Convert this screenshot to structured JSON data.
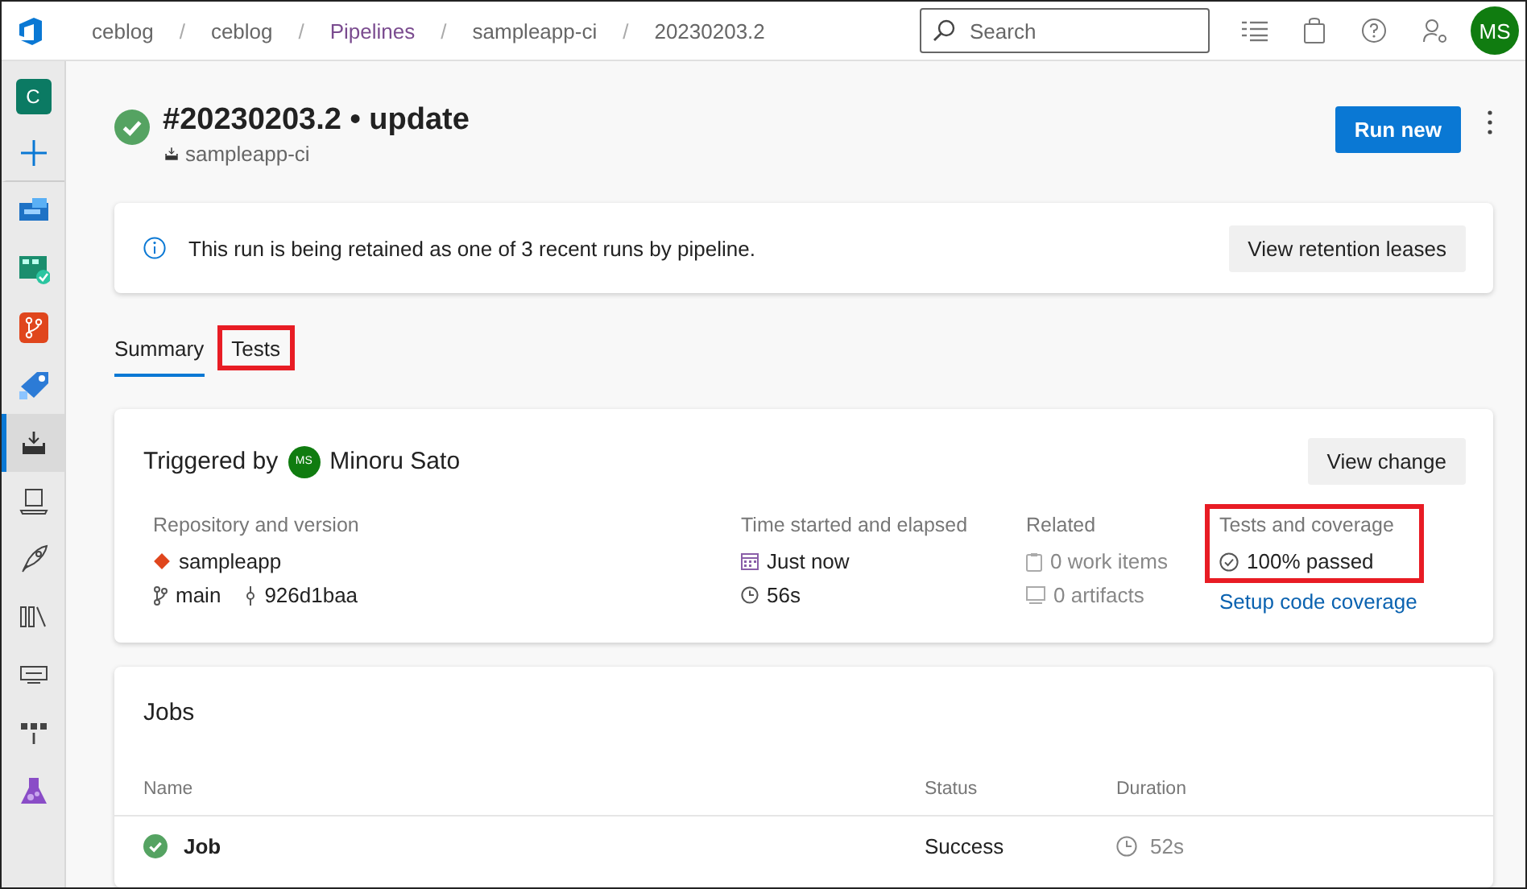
{
  "breadcrumbs": [
    {
      "label": "ceblog",
      "kind": "link"
    },
    {
      "separator": "/",
      "label": "ceblog",
      "kind": "link"
    },
    {
      "separator": "/",
      "label": "Pipelines",
      "kind": "area"
    },
    {
      "separator": "/",
      "label": "sampleapp-ci",
      "kind": "link"
    },
    {
      "separator": "/",
      "label": "20230203.2",
      "kind": "current"
    }
  ],
  "search": {
    "placeholder": "Search"
  },
  "user_avatar": "MS",
  "sidebar": {
    "project_badge": "C",
    "items": [
      {
        "kind": "add",
        "selected": false
      },
      {
        "kind": "overview",
        "selected": false
      },
      {
        "kind": "boards",
        "selected": false
      },
      {
        "kind": "repos",
        "selected": false
      },
      {
        "kind": "pipelines",
        "selected": false
      },
      {
        "kind": "builds",
        "selected": true
      },
      {
        "kind": "environments",
        "selected": false
      },
      {
        "kind": "releases",
        "selected": false
      },
      {
        "kind": "library",
        "selected": false
      },
      {
        "kind": "taskgroups",
        "selected": false
      },
      {
        "kind": "deploymentgroups",
        "selected": false
      },
      {
        "kind": "testplans",
        "selected": false
      }
    ]
  },
  "run": {
    "succeeded": true,
    "title": "#20230203.2 • update",
    "pipeline": "sampleapp-ci",
    "primary_button": "Run new"
  },
  "banner": {
    "message": "This run is being retained as one of 3 recent runs by pipeline.",
    "button": "View retention leases"
  },
  "tabs": [
    {
      "label": "Summary",
      "selected": true,
      "highlighted": false
    },
    {
      "label": "Tests",
      "selected": false,
      "highlighted": true
    }
  ],
  "summary": {
    "triggered_label": "Triggered by",
    "avatar": "MS",
    "user": "Minoru Sato",
    "button": "View change",
    "repository": {
      "heading": "Repository and version",
      "repo": "sampleapp",
      "branch": "main",
      "commit": "926d1baa"
    },
    "time": {
      "heading": "Time started and elapsed",
      "started": "Just now",
      "elapsed": "56s"
    },
    "related": {
      "heading": "Related",
      "work_items": "0 work items",
      "artifacts": "0 artifacts"
    },
    "tests": {
      "heading": "Tests and coverage",
      "result": "100% passed",
      "link": "Setup code coverage",
      "highlighted": true
    }
  },
  "jobs": {
    "title": "Jobs",
    "columns": [
      "Name",
      "Status",
      "Duration"
    ],
    "rows": [
      {
        "name": "Job",
        "status": "Success",
        "duration": "52s",
        "succeeded": true
      }
    ]
  }
}
